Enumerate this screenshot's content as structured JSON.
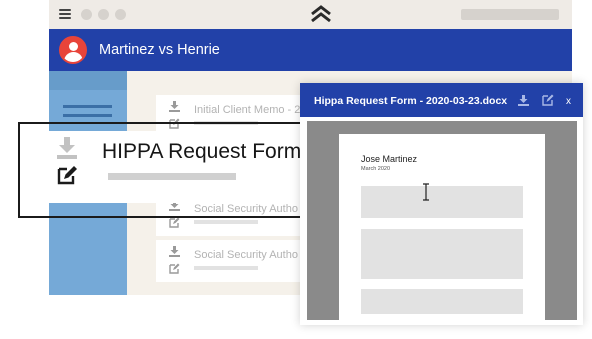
{
  "titlebar": {
    "menu_icon": "hamburger-menu-icon",
    "logo_icon": "chevron-stack-logo"
  },
  "header": {
    "case_title": "Martinez vs Henrie",
    "avatar_icon": "user-avatar-icon"
  },
  "documents": [
    {
      "title": "Initial Client Memo - 20",
      "download_icon": "download-icon",
      "edit_icon": "edit-icon"
    },
    {
      "title": "Social Security Autho",
      "download_icon": "download-icon",
      "edit_icon": "edit-icon"
    },
    {
      "title": "Social Security Autho",
      "download_icon": "download-icon",
      "edit_icon": "edit-icon"
    }
  ],
  "callout": {
    "title": "HIPPA Request Form"
  },
  "viewer": {
    "title": "Hippa Request Form - 2020-03-23.docx",
    "close_label": "x",
    "page": {
      "name": "Jose Martinez",
      "date": "March 2020"
    }
  },
  "colors": {
    "brand_blue": "#2241a8",
    "avatar_red": "#e8443a",
    "sidebar_blue": "#75a9d7",
    "app_background": "#f5f1ea"
  }
}
